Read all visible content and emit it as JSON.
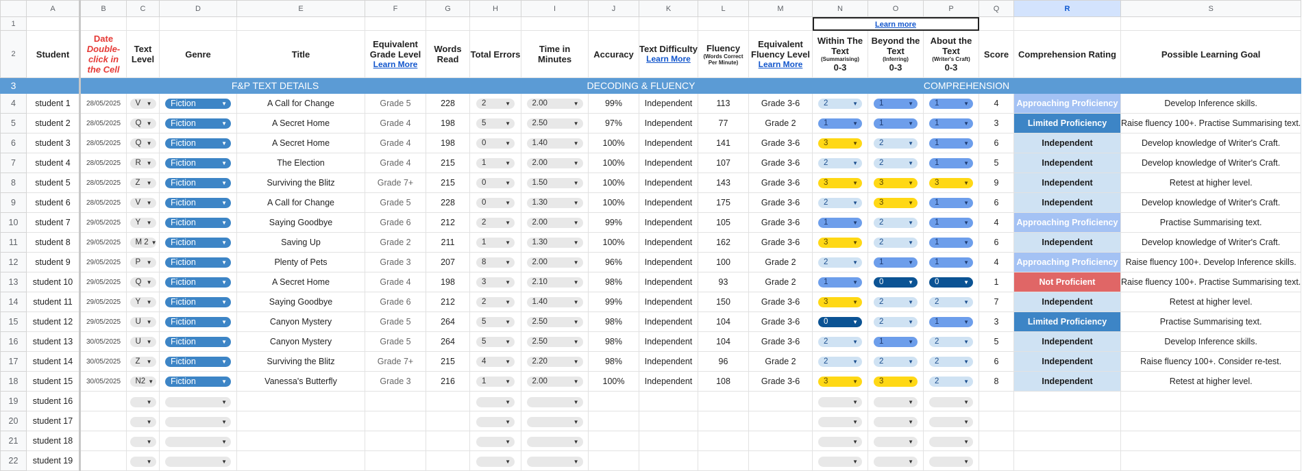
{
  "column_letters": [
    "A",
    "B",
    "C",
    "D",
    "E",
    "F",
    "G",
    "H",
    "I",
    "J",
    "K",
    "L",
    "M",
    "N",
    "O",
    "P",
    "Q",
    "R",
    "S"
  ],
  "selected_column": "R",
  "row1_link": "Learn more",
  "headers": {
    "student": "Student",
    "date_title": "Date",
    "date_note": "Double-click in the Cell",
    "text_level": "Text Level",
    "genre": "Genre",
    "title": "Title",
    "equiv_grade": "Equivalent Grade Level",
    "words_read": "Words Read",
    "total_errors": "Total Errors",
    "time": "Time in Minutes",
    "accuracy": "Accuracy",
    "text_difficulty": "Text Difficulty",
    "fluency": "Fluency",
    "fluency_sub": "(Words Correct Per Minute)",
    "equiv_fluency": "Equivalent Fluency Level",
    "within": "Within The Text",
    "within_sub": "(Summarising)",
    "beyond": "Beyond the Text",
    "beyond_sub": "(Inferring)",
    "about": "About the Text",
    "about_sub": "(Writer's Craft)",
    "range": "0-3",
    "score": "Score",
    "comp_rating": "Comprehension Rating",
    "learning_goal": "Possible Learning Goal",
    "learn_more": "Learn More"
  },
  "sections": {
    "fp": "F&P TEXT DETAILS",
    "decoding": "DECODING & FLUENCY",
    "comprehension": "COMPREHENSION"
  },
  "rows": [
    {
      "n": "4",
      "student": "student 1",
      "date": "28/05/2025",
      "level": "V",
      "genre": "Fiction",
      "title": "A Call for Change",
      "grade": "Grade 5",
      "words": "228",
      "errors": "2",
      "time": "2.00",
      "accuracy": "99%",
      "difficulty": "Independent",
      "fluency": "113",
      "flevel": "Grade 3-6",
      "within": "2",
      "beyond": "1",
      "about": "1",
      "score": "4",
      "rating": "Approaching Proficiency",
      "goal": "Develop Inference skills."
    },
    {
      "n": "5",
      "student": "student 2",
      "date": "28/05/2025",
      "level": "Q",
      "genre": "Fiction",
      "title": "A Secret Home",
      "grade": "Grade 4",
      "words": "198",
      "errors": "5",
      "time": "2.50",
      "accuracy": "97%",
      "difficulty": "Independent",
      "fluency": "77",
      "flevel": "Grade 2",
      "within": "1",
      "beyond": "1",
      "about": "1",
      "score": "3",
      "rating": "Limited Proficiency",
      "goal": "Raise fluency 100+. Practise Summarising text."
    },
    {
      "n": "6",
      "student": "student 3",
      "date": "28/05/2025",
      "level": "Q",
      "genre": "Fiction",
      "title": "A Secret Home",
      "grade": "Grade 4",
      "words": "198",
      "errors": "0",
      "time": "1.40",
      "accuracy": "100%",
      "difficulty": "Independent",
      "fluency": "141",
      "flevel": "Grade 3-6",
      "within": "3",
      "beyond": "2",
      "about": "1",
      "score": "6",
      "rating": "Independent",
      "goal": "Develop knowledge of Writer's Craft."
    },
    {
      "n": "7",
      "student": "student 4",
      "date": "28/05/2025",
      "level": "R",
      "genre": "Fiction",
      "title": "The Election",
      "grade": "Grade 4",
      "words": "215",
      "errors": "1",
      "time": "2.00",
      "accuracy": "100%",
      "difficulty": "Independent",
      "fluency": "107",
      "flevel": "Grade 3-6",
      "within": "2",
      "beyond": "2",
      "about": "1",
      "score": "5",
      "rating": "Independent",
      "goal": "Develop knowledge of Writer's Craft."
    },
    {
      "n": "8",
      "student": "student 5",
      "date": "28/05/2025",
      "level": "Z",
      "genre": "Fiction",
      "title": "Surviving the Blitz",
      "grade": "Grade 7+",
      "words": "215",
      "errors": "0",
      "time": "1.50",
      "accuracy": "100%",
      "difficulty": "Independent",
      "fluency": "143",
      "flevel": "Grade 3-6",
      "within": "3",
      "beyond": "3",
      "about": "3",
      "score": "9",
      "rating": "Independent",
      "goal": "Retest at higher level."
    },
    {
      "n": "9",
      "student": "student 6",
      "date": "28/05/2025",
      "level": "V",
      "genre": "Fiction",
      "title": "A Call for Change",
      "grade": "Grade 5",
      "words": "228",
      "errors": "0",
      "time": "1.30",
      "accuracy": "100%",
      "difficulty": "Independent",
      "fluency": "175",
      "flevel": "Grade 3-6",
      "within": "2",
      "beyond": "3",
      "about": "1",
      "score": "6",
      "rating": "Independent",
      "goal": "Develop knowledge of Writer's Craft."
    },
    {
      "n": "10",
      "student": "student 7",
      "date": "29/05/2025",
      "level": "Y",
      "genre": "Fiction",
      "title": "Saying Goodbye",
      "grade": "Grade 6",
      "words": "212",
      "errors": "2",
      "time": "2.00",
      "accuracy": "99%",
      "difficulty": "Independent",
      "fluency": "105",
      "flevel": "Grade 3-6",
      "within": "1",
      "beyond": "2",
      "about": "1",
      "score": "4",
      "rating": "Approaching Proficiency",
      "goal": "Practise Summarising text."
    },
    {
      "n": "11",
      "student": "student 8",
      "date": "29/05/2025",
      "level": "M 2",
      "genre": "Fiction",
      "title": "Saving Up",
      "grade": "Grade 2",
      "words": "211",
      "errors": "1",
      "time": "1.30",
      "accuracy": "100%",
      "difficulty": "Independent",
      "fluency": "162",
      "flevel": "Grade 3-6",
      "within": "3",
      "beyond": "2",
      "about": "1",
      "score": "6",
      "rating": "Independent",
      "goal": "Develop knowledge of Writer's Craft."
    },
    {
      "n": "12",
      "student": "student 9",
      "date": "29/05/2025",
      "level": "P",
      "genre": "Fiction",
      "title": "Plenty of Pets",
      "grade": "Grade 3",
      "words": "207",
      "errors": "8",
      "time": "2.00",
      "accuracy": "96%",
      "difficulty": "Independent",
      "fluency": "100",
      "flevel": "Grade 2",
      "within": "2",
      "beyond": "1",
      "about": "1",
      "score": "4",
      "rating": "Approaching Proficiency",
      "goal": "Raise fluency 100+. Develop Inference skills."
    },
    {
      "n": "13",
      "student": "student 10",
      "date": "29/05/2025",
      "level": "Q",
      "genre": "Fiction",
      "title": "A Secret Home",
      "grade": "Grade 4",
      "words": "198",
      "errors": "3",
      "time": "2.10",
      "accuracy": "98%",
      "difficulty": "Independent",
      "fluency": "93",
      "flevel": "Grade 2",
      "within": "1",
      "beyond": "0",
      "about": "0",
      "score": "1",
      "rating": "Not Proficient",
      "goal": "Raise fluency 100+. Practise Summarising text."
    },
    {
      "n": "14",
      "student": "student 11",
      "date": "29/05/2025",
      "level": "Y",
      "genre": "Fiction",
      "title": "Saying Goodbye",
      "grade": "Grade 6",
      "words": "212",
      "errors": "2",
      "time": "1.40",
      "accuracy": "99%",
      "difficulty": "Independent",
      "fluency": "150",
      "flevel": "Grade 3-6",
      "within": "3",
      "beyond": "2",
      "about": "2",
      "score": "7",
      "rating": "Independent",
      "goal": "Retest at higher level."
    },
    {
      "n": "15",
      "student": "student 12",
      "date": "29/05/2025",
      "level": "U",
      "genre": "Fiction",
      "title": "Canyon Mystery",
      "grade": "Grade 5",
      "words": "264",
      "errors": "5",
      "time": "2.50",
      "accuracy": "98%",
      "difficulty": "Independent",
      "fluency": "104",
      "flevel": "Grade 3-6",
      "within": "0",
      "beyond": "2",
      "about": "1",
      "score": "3",
      "rating": "Limited Proficiency",
      "goal": "Practise Summarising text."
    },
    {
      "n": "16",
      "student": "student 13",
      "date": "30/05/2025",
      "level": "U",
      "genre": "Fiction",
      "title": "Canyon Mystery",
      "grade": "Grade 5",
      "words": "264",
      "errors": "5",
      "time": "2.50",
      "accuracy": "98%",
      "difficulty": "Independent",
      "fluency": "104",
      "flevel": "Grade 3-6",
      "within": "2",
      "beyond": "1",
      "about": "2",
      "score": "5",
      "rating": "Independent",
      "goal": "Develop Inference skills."
    },
    {
      "n": "17",
      "student": "student 14",
      "date": "30/05/2025",
      "level": "Z",
      "genre": "Fiction",
      "title": "Surviving the Blitz",
      "grade": "Grade 7+",
      "words": "215",
      "errors": "4",
      "time": "2.20",
      "accuracy": "98%",
      "difficulty": "Independent",
      "fluency": "96",
      "flevel": "Grade 2",
      "within": "2",
      "beyond": "2",
      "about": "2",
      "score": "6",
      "rating": "Independent",
      "goal": "Raise fluency 100+. Consider re-test."
    },
    {
      "n": "18",
      "student": "student 15",
      "date": "30/05/2025",
      "level": "N2",
      "genre": "Fiction",
      "title": "Vanessa's Butterfly",
      "grade": "Grade 3",
      "words": "216",
      "errors": "1",
      "time": "2.00",
      "accuracy": "100%",
      "difficulty": "Independent",
      "fluency": "108",
      "flevel": "Grade 3-6",
      "within": "3",
      "beyond": "3",
      "about": "2",
      "score": "8",
      "rating": "Independent",
      "goal": "Retest at higher level."
    },
    {
      "n": "19",
      "student": "student 16"
    },
    {
      "n": "20",
      "student": "student 17"
    },
    {
      "n": "21",
      "student": "student 18"
    },
    {
      "n": "22",
      "student": "student 19"
    }
  ],
  "rating_colors": {
    "Approaching Proficiency": "#a4c2f4",
    "Limited Proficiency": "#3d85c6",
    "Independent": "#cfe2f3",
    "Not Proficient": "#e06666"
  }
}
